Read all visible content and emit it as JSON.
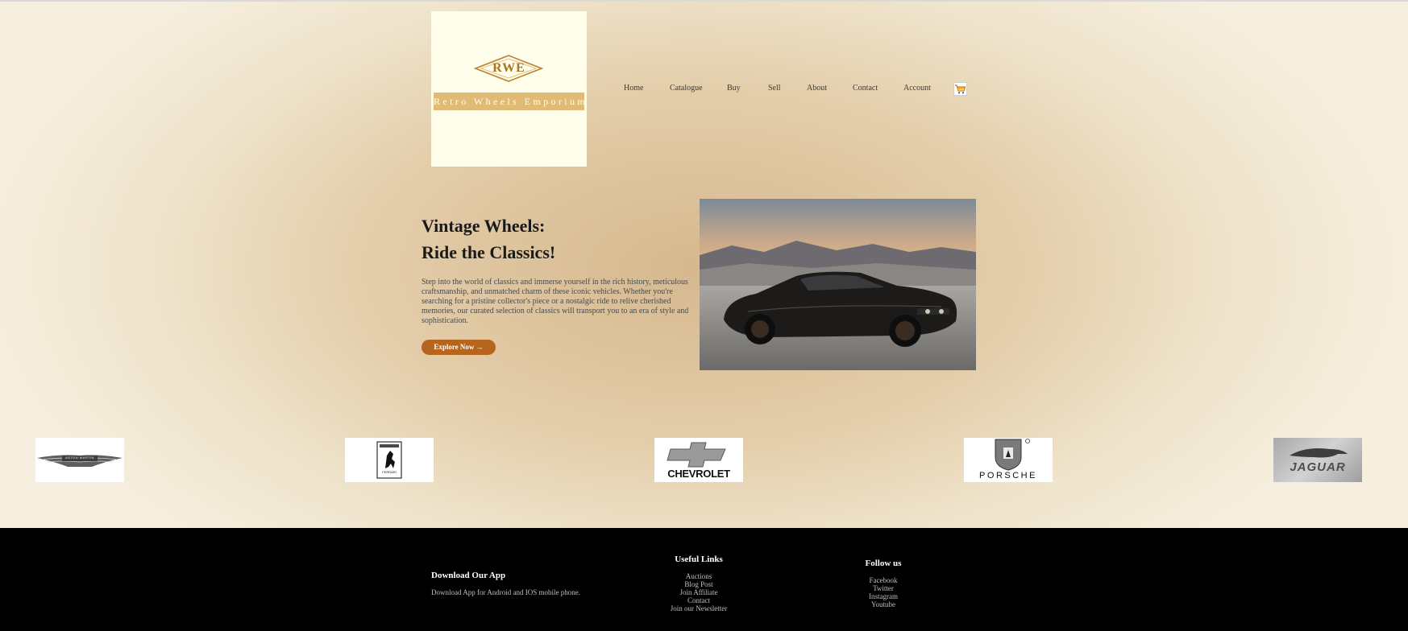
{
  "brand": {
    "monogram": "RWE",
    "name": "Retro Wheels Emporium"
  },
  "nav": {
    "items": [
      "Home",
      "Catalogue",
      "Buy",
      "Sell",
      "About",
      "Contact",
      "Account"
    ],
    "cart_icon": "shopping-cart-icon"
  },
  "hero": {
    "title_line1": "Vintage Wheels:",
    "title_line2": "Ride the Classics!",
    "body": "Step into the world of classics and immerse yourself in the rich history, meticulous craftsmanship, and unmatched charm of these iconic vehicles. Whether you're searching for a pristine collector's piece or a nostalgic ride to relive cherished memories, our curated selection of classics will transport you to an era of style and sophistication.",
    "cta_label": "Explore Now →"
  },
  "brands": {
    "aston_martin": "ASTON MARTIN",
    "ferrari": "FERRARI",
    "chevrolet": "CHEVROLET",
    "porsche": "PORSCHE",
    "jaguar": "JAGUAR"
  },
  "footer": {
    "app_title": "Download Our App",
    "app_text": "Download App for Android and IOS mobile phone.",
    "links_title": "Useful Links",
    "links": [
      "Auctions",
      "Blog Post",
      "Join Affiliate",
      "Contact",
      "Join our Newsletter"
    ],
    "follow_title": "Follow us",
    "social": [
      "Facebook",
      "Twitter",
      "Instagram",
      "Youtube"
    ]
  },
  "colors": {
    "accent": "#b5651d",
    "logo_gold": "#a9741e",
    "logo_bg": "#fffeea",
    "footer_bg": "#000000"
  }
}
